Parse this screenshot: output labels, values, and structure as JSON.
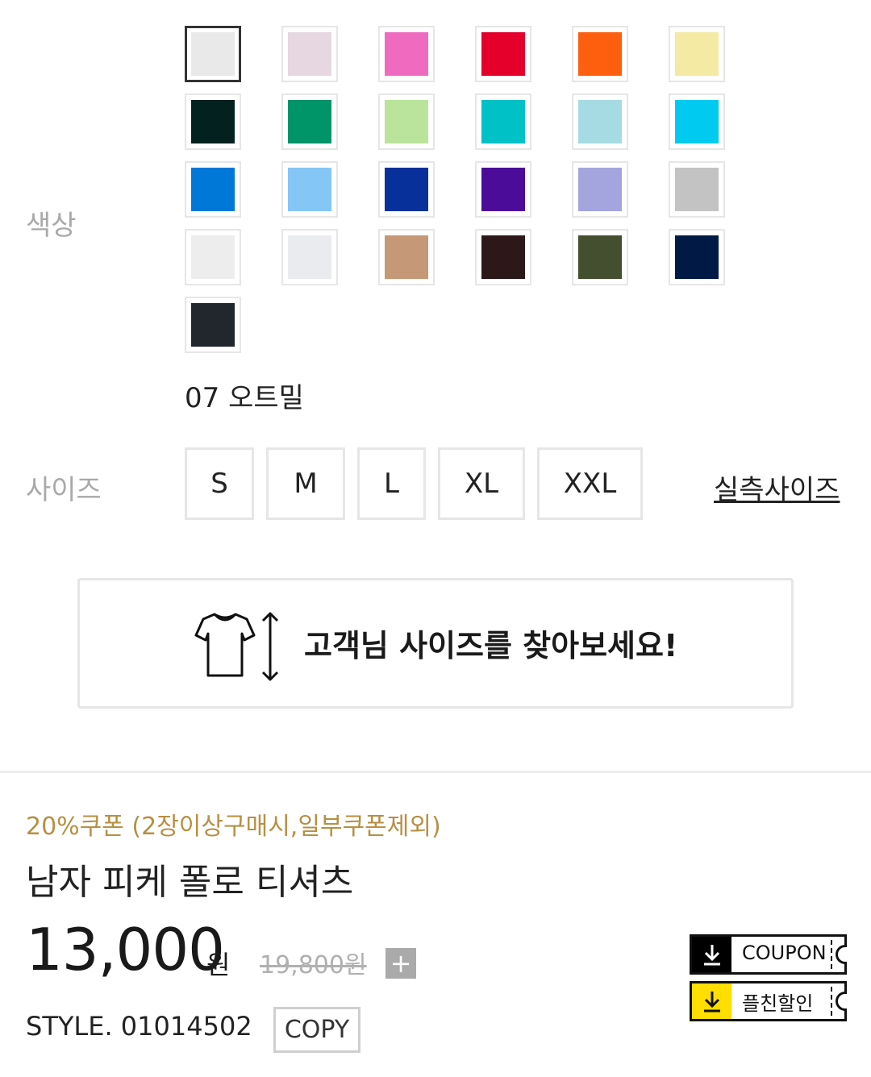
{
  "color_option": {
    "label": "색상",
    "selected_name": "07 오트밀",
    "swatches": [
      {
        "color": "#e9e9e9",
        "selected": true
      },
      {
        "color": "#e7d7e1"
      },
      {
        "color": "#ef6bbf"
      },
      {
        "color": "#e4002b"
      },
      {
        "color": "#fe5f0e"
      },
      {
        "color": "#f4eaa4"
      },
      {
        "color": "#03221f"
      },
      {
        "color": "#009469"
      },
      {
        "color": "#bae49b"
      },
      {
        "color": "#00c1c6"
      },
      {
        "color": "#a7dbe3"
      },
      {
        "color": "#00caf0"
      },
      {
        "color": "#0078d8"
      },
      {
        "color": "#84c6f6"
      },
      {
        "color": "#07309a"
      },
      {
        "color": "#4c0c9a"
      },
      {
        "color": "#a4a5de"
      },
      {
        "color": "#c3c3c3"
      },
      {
        "color": "#ededed"
      },
      {
        "color": "#e9ebef"
      },
      {
        "color": "#c59878"
      },
      {
        "color": "#2d1819"
      },
      {
        "color": "#434f2e"
      },
      {
        "color": "#001a45"
      },
      {
        "color": "#20272d"
      }
    ]
  },
  "size_option": {
    "label": "사이즈",
    "sizes": [
      "S",
      "M",
      "L",
      "XL",
      "XXL"
    ],
    "guide_link": "실측사이즈"
  },
  "size_finder": {
    "text": "고객님 사이즈를 찾아보세요!",
    "icon": "tshirt-measure-icon"
  },
  "product": {
    "coupon_note": "20%쿠폰 (2장이상구매시,일부쿠폰제외)",
    "name": "남자 피케 폴로 티셔츠",
    "price": "13,000",
    "price_unit": "원",
    "original_price": "19,800원",
    "plus_label": "+",
    "style_no": "STYLE. 01014502",
    "copy_label": "COPY"
  },
  "coupons": {
    "coupon_label": "COUPON",
    "friend_discount_label": "플친할인",
    "coupon_icon_bg": "#000000",
    "friend_icon_bg": "#ffde00"
  }
}
